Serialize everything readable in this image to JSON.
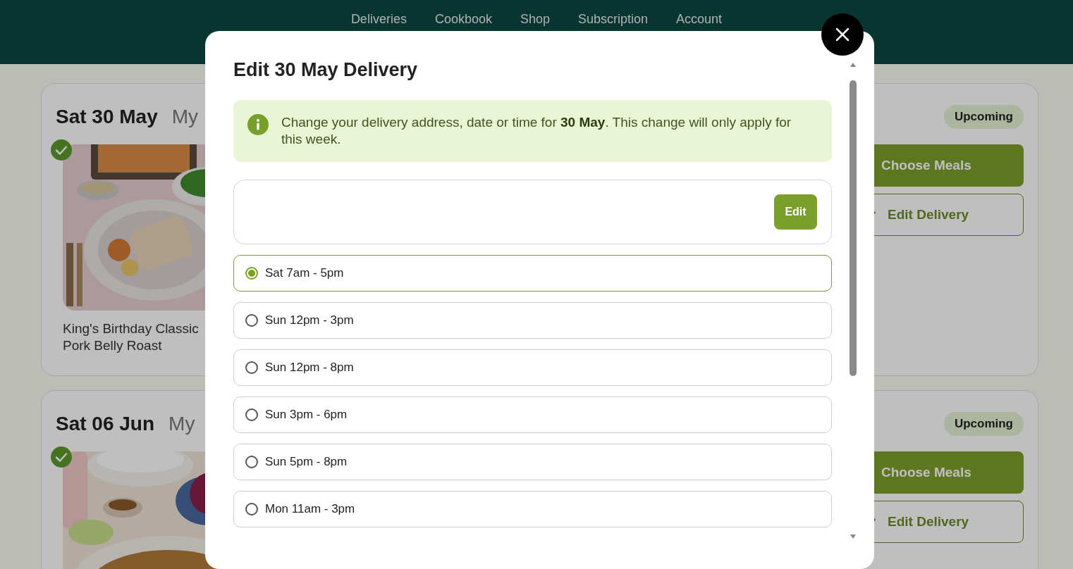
{
  "nav": [
    {
      "label": "Deliveries"
    },
    {
      "label": "Cookbook"
    },
    {
      "label": "Shop"
    },
    {
      "label": "Subscription"
    },
    {
      "label": "Account"
    }
  ],
  "deliveries": [
    {
      "date": "Sat 30 May",
      "subtitle": "My",
      "status": "Upcoming",
      "meal_checked": true,
      "meal_name": "King's Birthday Classic Pork Belly Roast",
      "actions": [
        "Choose Meals",
        "Edit Delivery"
      ]
    },
    {
      "date": "Sat 06 Jun",
      "subtitle": "My",
      "status": "Upcoming",
      "meal_checked": true,
      "actions": [
        "Choose Meals",
        "Edit Delivery"
      ]
    }
  ],
  "modal": {
    "title": "Edit 30 May Delivery",
    "notice": "Change your delivery address, date or time for **30 May**. This change will only apply for this week.",
    "address_button": "Edit",
    "time_slots": [
      {
        "label": "Sat 7am - 5pm",
        "selected": true
      },
      {
        "label": "Sun 12pm - 3pm",
        "selected": false
      },
      {
        "label": "Sun 12pm - 8pm",
        "selected": false
      },
      {
        "label": "Sun 3pm - 6pm",
        "selected": false
      },
      {
        "label": "Sun 5pm - 8pm",
        "selected": false
      },
      {
        "label": "Mon 11am - 3pm",
        "selected": false
      }
    ]
  }
}
